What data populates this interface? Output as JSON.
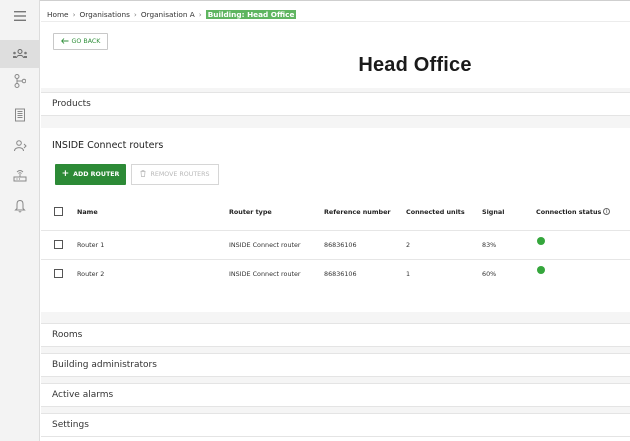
{
  "breadcrumb": {
    "items": [
      "Home",
      "Organisations",
      "Organisation A"
    ],
    "current": "Building: Head Office",
    "separator": "›"
  },
  "go_back": {
    "label": "GO BACK",
    "icon": "arrow-left-icon"
  },
  "page_title": "Head Office",
  "sidebar": {
    "items": [
      {
        "icon": "hamburger-menu-icon",
        "active": false
      },
      {
        "icon": "users-group-icon",
        "active": true
      },
      {
        "icon": "hierarchy-icon",
        "active": false
      },
      {
        "icon": "building-icon",
        "active": false
      },
      {
        "icon": "user-management-icon",
        "active": false
      },
      {
        "icon": "router-icon",
        "active": false
      },
      {
        "icon": "bell-icon",
        "active": false
      }
    ]
  },
  "sections": {
    "products": "Products",
    "rooms": "Rooms",
    "building_admins": "Building administrators",
    "active_alarms": "Active alarms",
    "settings": "Settings"
  },
  "routers": {
    "title": "INSIDE Connect routers",
    "add_label": "ADD ROUTER",
    "remove_label": "REMOVE ROUTERS",
    "columns": {
      "name": "Name",
      "router_type": "Router type",
      "reference_number": "Reference number",
      "connected_units": "Connected units",
      "signal": "Signal",
      "connection_status": "Connection status"
    },
    "rows": [
      {
        "name": "Router 1",
        "router_type": "INSIDE Connect router",
        "reference_number": "86836106",
        "connected_units": "2",
        "signal": "83%",
        "status": "connected"
      },
      {
        "name": "Router 2",
        "router_type": "INSIDE Connect router",
        "reference_number": "86836106",
        "connected_units": "1",
        "signal": "60%",
        "status": "connected"
      }
    ]
  },
  "colors": {
    "accent_green": "#2c8a36",
    "status_green": "#35a63c",
    "breadcrumb_highlight": "#5fb560"
  }
}
